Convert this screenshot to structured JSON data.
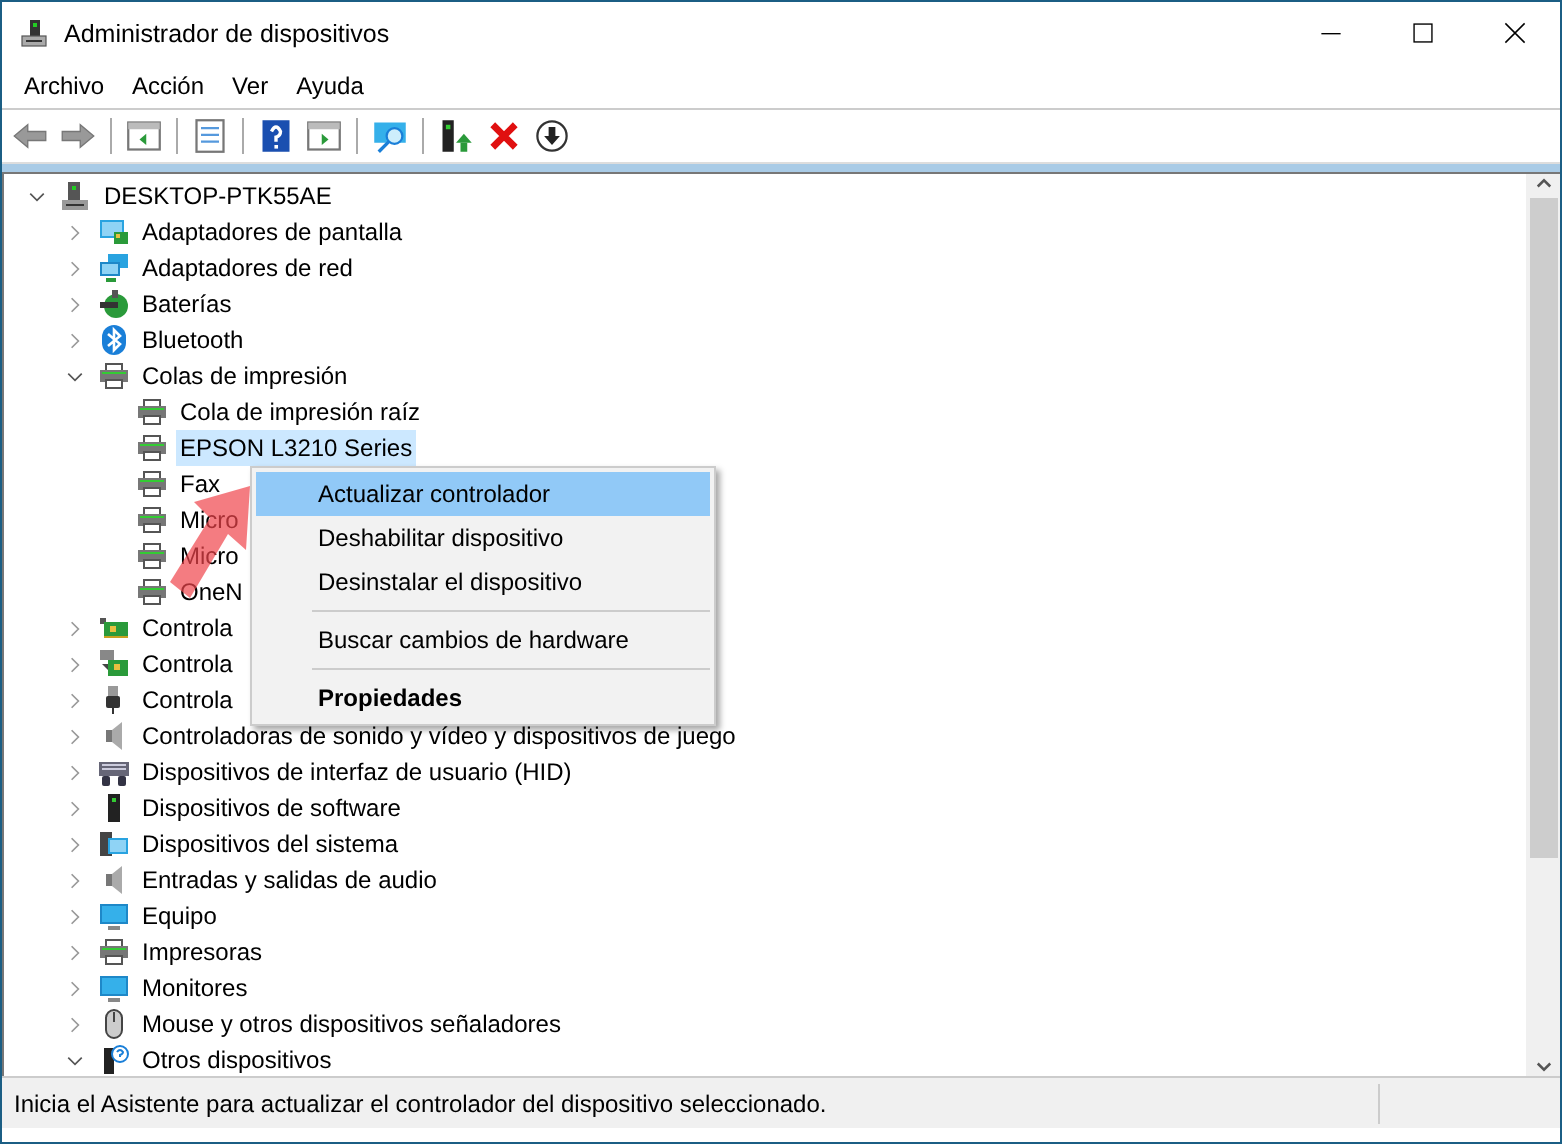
{
  "window": {
    "title": "Administrador de dispositivos"
  },
  "menu_bar": [
    "Archivo",
    "Acción",
    "Ver",
    "Ayuda"
  ],
  "tree": {
    "label": "DESKTOP-PTK55AE",
    "kind": "computer",
    "expanded": true,
    "selected": false,
    "children": [
      {
        "label": "Adaptadores de pantalla",
        "kind": "display",
        "expanded": false,
        "selected": false
      },
      {
        "label": "Adaptadores de red",
        "kind": "network",
        "expanded": false,
        "selected": false
      },
      {
        "label": "Baterías",
        "kind": "battery",
        "expanded": false,
        "selected": false
      },
      {
        "label": "Bluetooth",
        "kind": "bluetooth",
        "expanded": false,
        "selected": false
      },
      {
        "label": "Colas de impresión",
        "kind": "printer",
        "expanded": true,
        "selected": false,
        "children": [
          {
            "label": "Cola de impresión raíz",
            "kind": "printer",
            "selected": false
          },
          {
            "label": "EPSON L3210 Series",
            "kind": "printer",
            "selected": true
          },
          {
            "label": "Fax",
            "kind": "printer",
            "selected": false
          },
          {
            "label": "Micro",
            "kind": "printer",
            "selected": false
          },
          {
            "label": "Micro",
            "kind": "printer",
            "selected": false
          },
          {
            "label": "OneN",
            "kind": "printer",
            "selected": false
          }
        ]
      },
      {
        "label": "Controla",
        "kind": "card",
        "expanded": false,
        "selected": false
      },
      {
        "label": "Controla",
        "kind": "storage",
        "expanded": false,
        "selected": false
      },
      {
        "label": "Controla",
        "kind": "usb",
        "expanded": false,
        "selected": false
      },
      {
        "label": "Controladoras de sonido y vídeo y dispositivos de juego",
        "kind": "speaker",
        "expanded": false,
        "selected": false
      },
      {
        "label": "Dispositivos de interfaz de usuario (HID)",
        "kind": "keyboard",
        "expanded": false,
        "selected": false
      },
      {
        "label": "Dispositivos de software",
        "kind": "tower",
        "expanded": false,
        "selected": false
      },
      {
        "label": "Dispositivos del sistema",
        "kind": "system",
        "expanded": false,
        "selected": false
      },
      {
        "label": "Entradas y salidas de audio",
        "kind": "speaker",
        "expanded": false,
        "selected": false
      },
      {
        "label": "Equipo",
        "kind": "monitor",
        "expanded": false,
        "selected": false
      },
      {
        "label": "Impresoras",
        "kind": "printer",
        "expanded": false,
        "selected": false
      },
      {
        "label": "Monitores",
        "kind": "monitor",
        "expanded": false,
        "selected": false
      },
      {
        "label": "Mouse y otros dispositivos señaladores",
        "kind": "mouse",
        "expanded": false,
        "selected": false
      },
      {
        "label": "Otros dispositivos",
        "kind": "unknown",
        "expanded": true,
        "selected": false
      }
    ]
  },
  "context_menu": [
    {
      "kind": "item",
      "label": "Actualizar controlador",
      "selected": true,
      "default": false
    },
    {
      "kind": "item",
      "label": "Deshabilitar dispositivo",
      "selected": false,
      "default": false
    },
    {
      "kind": "item",
      "label": "Desinstalar el dispositivo",
      "selected": false,
      "default": false
    },
    {
      "kind": "separator"
    },
    {
      "kind": "item",
      "label": "Buscar cambios de hardware",
      "selected": false,
      "default": false
    },
    {
      "kind": "separator"
    },
    {
      "kind": "item",
      "label": "Propiedades",
      "selected": false,
      "default": true
    }
  ],
  "status_bar": "Inicia el Asistente para actualizar el controlador del dispositivo seleccionado."
}
